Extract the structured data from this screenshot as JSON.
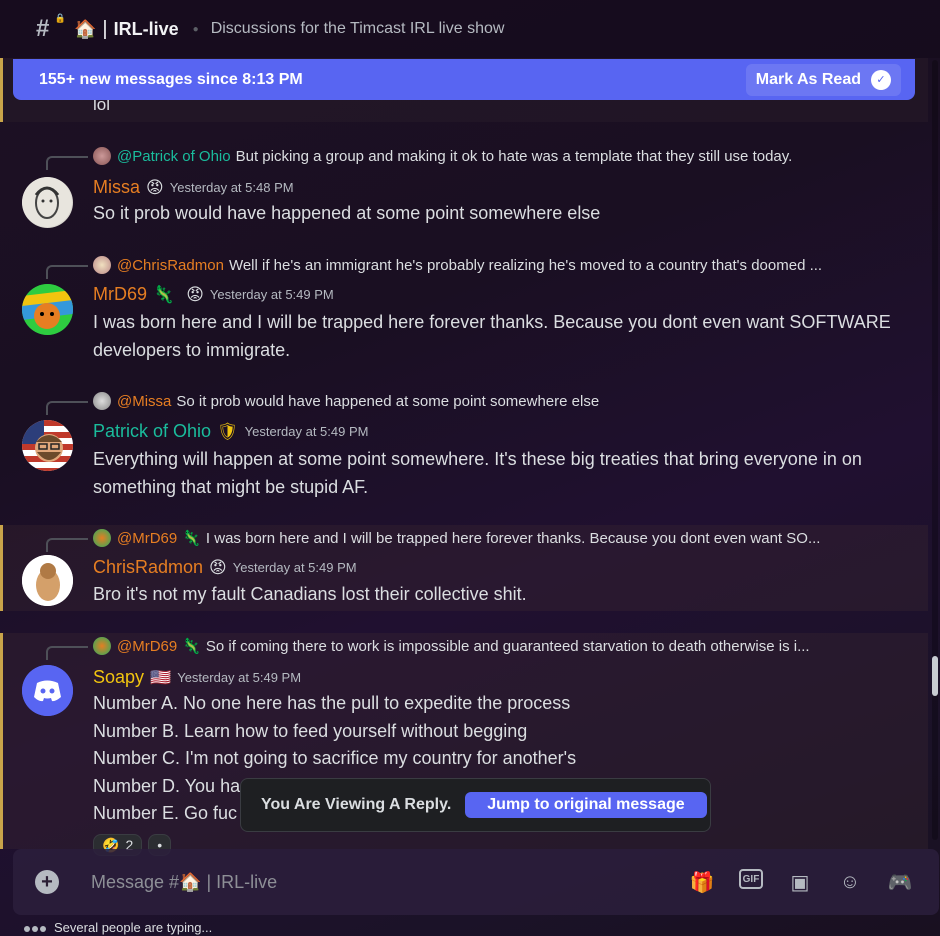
{
  "header": {
    "channel_emoji": "🏠",
    "channel_sep": "|",
    "channel_name": "IRL-live",
    "topic": "Discussions for the Timcast IRL live show"
  },
  "new_messages_bar": {
    "text": "155+ new messages since 8:13 PM",
    "mark_read": "Mark As Read"
  },
  "partial_message": {
    "text": "lol"
  },
  "messages": [
    {
      "reply_mention": "@Patrick of Ohio",
      "reply_text": "But picking a group and making it ok to hate was a template that they still use today.",
      "username": "Missa",
      "username_color": "#e67e22",
      "badge": "😡",
      "timestamp": "Yesterday at 5:48 PM",
      "body": "So it prob would have happened at some point somewhere else"
    },
    {
      "reply_mention": "@ChrisRadmon",
      "reply_text": "Well if he's an immigrant he's probably realizing he's moved to a country that's doomed ...",
      "username": "MrD69",
      "username_color": "#e67e22",
      "badge": "🦎",
      "badge2": "😡",
      "timestamp": "Yesterday at 5:49 PM",
      "body": "I was born here and I will be trapped here forever thanks. Because you dont even want SOFTWARE developers to immigrate."
    },
    {
      "reply_mention": "@Missa",
      "reply_text": "So it prob would have happened at some point somewhere else",
      "username": "Patrick of Ohio",
      "username_color": "#1abc9c",
      "badge": "🛡",
      "timestamp": "Yesterday at 5:49 PM",
      "body": "Everything will happen at some point somewhere. It's these big treaties that bring everyone in on something that might be stupid AF."
    },
    {
      "reply_mention": "@MrD69",
      "reply_badge": "🦎",
      "reply_text": "I was born here and I will be trapped here forever thanks. Because you dont even want SO...",
      "username": "ChrisRadmon",
      "username_color": "#e67e22",
      "badge": "😡",
      "timestamp": "Yesterday at 5:49 PM",
      "body": "Bro it's not my fault Canadians lost their collective shit."
    },
    {
      "reply_mention": "@MrD69",
      "reply_badge": "🦎",
      "reply_text": "So if coming there to work is impossible and guaranteed starvation to death otherwise is i...",
      "username": "Soapy",
      "username_color": "#f1c40f",
      "badge": "🇺🇸",
      "timestamp": "Yesterday at 5:49 PM",
      "lines": [
        "Number A. No one here has the pull to expedite the process",
        "Number B. Learn how to feed yourself without begging",
        "Number C. I'm not going to sacrifice my country for another's",
        "Number D. You ha",
        "Number E. Go fuc"
      ]
    }
  ],
  "reactions": [
    {
      "emoji": "🤣",
      "count": "2"
    },
    {
      "emoji": "•",
      "count": ""
    }
  ],
  "reply_toast": {
    "text": "You Are Viewing A Reply.",
    "button": "Jump to original message"
  },
  "composer": {
    "placeholder": "Message #🏠 | IRL-live"
  },
  "typing": "Several people are typing..."
}
